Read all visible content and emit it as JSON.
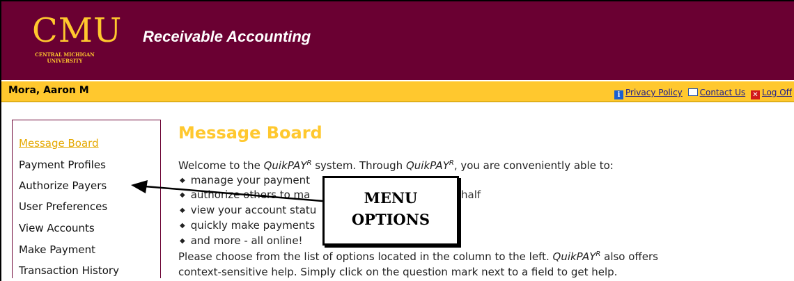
{
  "header": {
    "logo_text": "CMU",
    "logo_subtext_line1": "CENTRAL MICHIGAN",
    "logo_subtext_line2": "UNIVERSITY",
    "app_title": "Receivable Accounting"
  },
  "userbar": {
    "user_name": "Mora, Aaron M",
    "links": [
      {
        "label": "Privacy Policy",
        "icon": "info-icon"
      },
      {
        "label": "Contact Us",
        "icon": "mail-icon"
      },
      {
        "label": "Log Off",
        "icon": "close-icon"
      }
    ]
  },
  "sidebar": {
    "items": [
      {
        "label": "Message Board",
        "active": true
      },
      {
        "label": "Payment Profiles"
      },
      {
        "label": "Authorize Payers"
      },
      {
        "label": "User Preferences"
      },
      {
        "label": "View Accounts"
      },
      {
        "label": "Make Payment"
      },
      {
        "label": "Transaction History"
      }
    ]
  },
  "main": {
    "title": "Message Board",
    "intro_prefix": "Welcome to the ",
    "brand": "QuikPAY",
    "brand_sup": "R",
    "intro_middle": " system. Through ",
    "intro_suffix": ", you are conveniently able to:",
    "bullets": [
      "manage your payment",
      "authorize others to ma",
      "view your account statu",
      "quickly make payments",
      "and more - all online!"
    ],
    "bullet2_tail": "half",
    "para_prefix": "Please choose from the list of options located in the column to the left. ",
    "para_suffix": " also offers",
    "para_line2": "context-sensitive help. Simply click on the question mark next to a field to get help."
  },
  "annotation": {
    "callout_line1": "MENU",
    "callout_line2": "OPTIONS"
  },
  "colors": {
    "brand_maroon": "#6a0032",
    "brand_gold": "#ffc82e"
  }
}
